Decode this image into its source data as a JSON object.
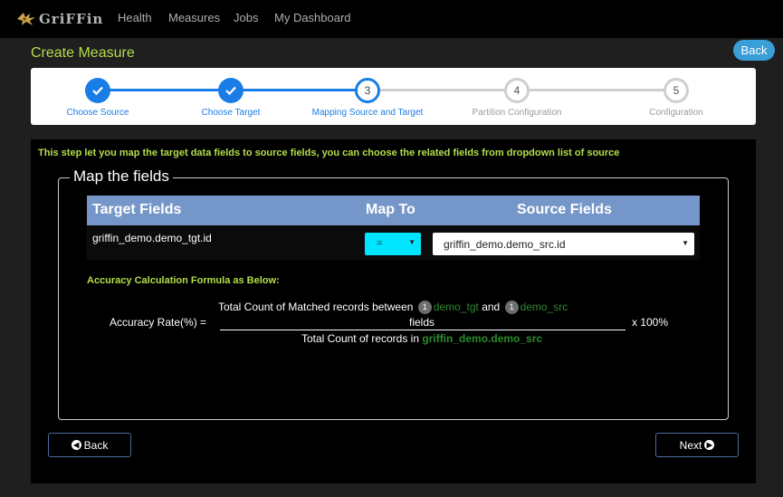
{
  "brand": {
    "name": "GriFFin"
  },
  "nav": {
    "items": [
      "Health",
      "Measures",
      "Jobs",
      "My Dashboard"
    ]
  },
  "page": {
    "title": "Create Measure",
    "back_label": "Back"
  },
  "steps": [
    {
      "number": "1",
      "label": "Choose Source",
      "state": "done"
    },
    {
      "number": "2",
      "label": "Choose Target",
      "state": "done"
    },
    {
      "number": "3",
      "label": "Mapping Source and Target",
      "state": "current"
    },
    {
      "number": "4",
      "label": "Partition Configuration",
      "state": "todo"
    },
    {
      "number": "5",
      "label": "Configuration",
      "state": "todo"
    }
  ],
  "instruction": "This step let you map the target data fields to source fields, you can choose the related fields from dropdown list of source",
  "mapping": {
    "legend": "Map the fields",
    "headers": {
      "target": "Target Fields",
      "map_to": "Map To",
      "source": "Source Fields"
    },
    "rows": [
      {
        "target": "griffin_demo.demo_tgt.id",
        "operator": "=",
        "source": "griffin_demo.demo_src.id"
      }
    ]
  },
  "formula": {
    "title": "Accuracy Calculation Formula as Below:",
    "lhs": "Accuracy Rate(%) =",
    "numerator_prefix": "Total Count of Matched records between",
    "badge1": "1",
    "target_name": "demo_tgt",
    "and_text": "and",
    "badge2": "1",
    "source_name": "demo_src",
    "numerator_suffix": "fields",
    "denominator_prefix": "Total Count of records in",
    "denominator_source": "griffin_demo.demo_src",
    "multiplier": "x 100%"
  },
  "buttons": {
    "back": "Back",
    "next": "Next"
  },
  "colors": {
    "accent_green": "#b6dd4b",
    "step_blue": "#1a7de6",
    "header_blue": "#7596c8",
    "map_cyan": "#00e5ff"
  }
}
